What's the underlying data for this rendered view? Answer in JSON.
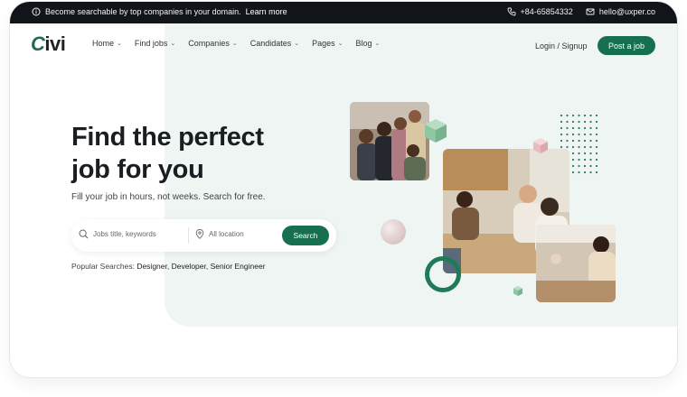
{
  "topbar": {
    "message": "Become searchable by top companies in your domain.",
    "link": "Learn more",
    "phone": "+84-65854332",
    "email": "hello@uxper.co"
  },
  "nav": {
    "logo": "Civi",
    "menu": [
      "Home",
      "Find jobs",
      "Companies",
      "Candidates",
      "Pages",
      "Blog"
    ],
    "login": "Login / Signup",
    "post_job": "Post a job"
  },
  "hero": {
    "title_line1": "Find the perfect",
    "title_line2": "job for you",
    "subtitle": "Fill your job in hours, not weeks. Search for free."
  },
  "search": {
    "keywords_placeholder": "Jobs title, keywords",
    "location_placeholder": "All location",
    "button": "Search"
  },
  "popular": {
    "label": "Popular Searches:",
    "tags": "Designer, Developer, Senior Engineer"
  },
  "colors": {
    "brand": "#16704f",
    "topbar": "#111418",
    "hero_bg": "#eff5f2"
  },
  "icons": [
    "info-icon",
    "phone-icon",
    "mail-icon",
    "search-icon",
    "location-pin-icon",
    "chevron-down-icon"
  ]
}
